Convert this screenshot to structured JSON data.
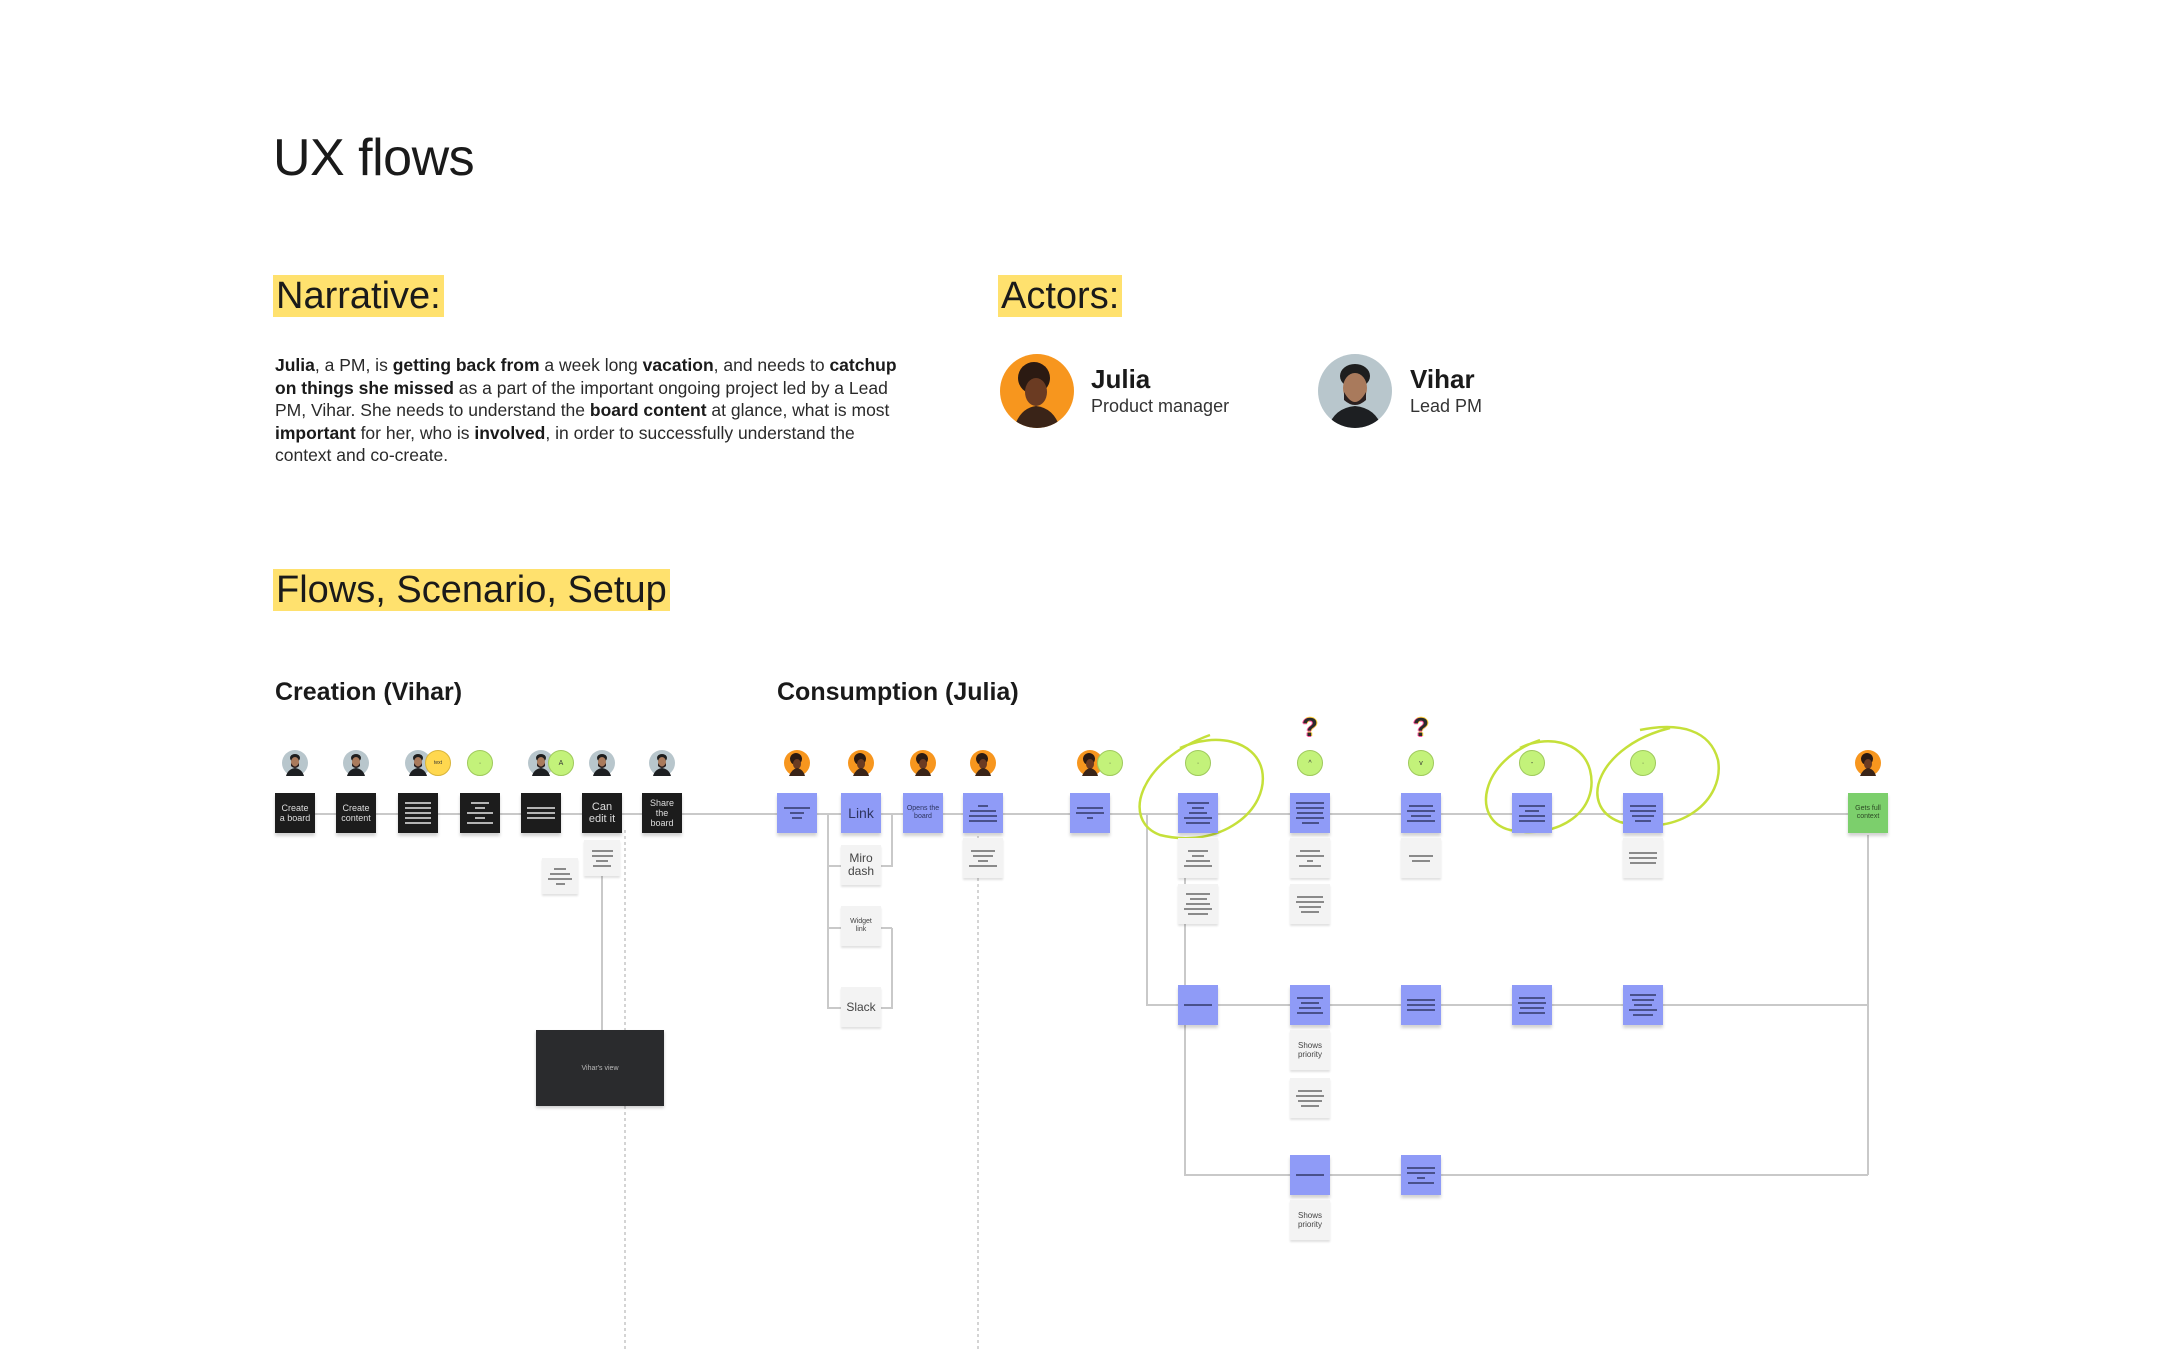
{
  "page": {
    "title": "UX flows"
  },
  "narrative": {
    "heading": "Narrative:",
    "segments": [
      {
        "text": "Julia",
        "bold": true
      },
      {
        "text": ", a PM, is ",
        "bold": false
      },
      {
        "text": "getting back from",
        "bold": true
      },
      {
        "text": " a week long ",
        "bold": false
      },
      {
        "text": "vacation",
        "bold": true
      },
      {
        "text": ", and needs to ",
        "bold": false
      },
      {
        "text": "catchup on things she missed",
        "bold": true
      },
      {
        "text": " as a part of the important ongoing project led by a Lead PM, Vihar. She needs to understand the ",
        "bold": false
      },
      {
        "text": "board content",
        "bold": true
      },
      {
        "text": " at glance, what is most ",
        "bold": false
      },
      {
        "text": "important",
        "bold": true
      },
      {
        "text": " for her, who is ",
        "bold": false
      },
      {
        "text": "involved",
        "bold": true
      },
      {
        "text": ", in order to successfully understand the context and co-create.",
        "bold": false
      }
    ]
  },
  "actors": {
    "heading": "Actors:",
    "list": [
      {
        "name": "Julia",
        "role": "Product manager",
        "avatar": "julia-avatar"
      },
      {
        "name": "Vihar",
        "role": "Lead PM",
        "avatar": "vihar-avatar"
      }
    ]
  },
  "flows": {
    "heading": "Flows, Scenario, Setup",
    "creation": {
      "heading": "Creation (Vihar)",
      "steps": [
        {
          "label": "Create a board",
          "actor": "vihar"
        },
        {
          "label": "Create content",
          "actor": "vihar"
        },
        {
          "label": "",
          "actor": "vihar",
          "badge": "yellow",
          "badge_text": "text"
        },
        {
          "label": "",
          "actor": "none",
          "badge": "green",
          "badge_text": "·"
        },
        {
          "label": "",
          "actor": "vihar",
          "badge": "green",
          "badge_text": "A"
        },
        {
          "label": "Can edit it",
          "actor": "vihar"
        },
        {
          "label": "Share the board",
          "actor": "vihar"
        }
      ],
      "result_box_label": "Vihar's view"
    },
    "consumption": {
      "heading": "Consumption (Julia)",
      "steps": [
        {
          "label": "",
          "actor": "julia"
        },
        {
          "label": "Link",
          "actor": "julia"
        },
        {
          "label": "Opens the board",
          "actor": "julia"
        },
        {
          "label": "",
          "actor": "julia"
        },
        {
          "label": "",
          "actor": "julia",
          "badge": "green",
          "badge_text": "·"
        },
        {
          "label": "",
          "actor": "none",
          "badge": "green",
          "badge_text": "·",
          "circled": true
        },
        {
          "label": "",
          "actor": "none",
          "badge": "green",
          "badge_text": "^",
          "question": true
        },
        {
          "label": "",
          "actor": "none",
          "badge": "green",
          "badge_text": "v",
          "question": true
        },
        {
          "label": "",
          "actor": "none",
          "badge": "green",
          "badge_text": "-",
          "circled": true
        },
        {
          "label": "",
          "actor": "none",
          "badge": "green",
          "badge_text": "·",
          "circled": true
        },
        {
          "label": "Gets full context",
          "actor": "julia",
          "final": true
        }
      ],
      "entry_channels": [
        "Miro dash",
        "Widget link",
        "Slack"
      ],
      "branch_notes": [
        "Shows priority",
        "Shows priority"
      ],
      "question_mark": "?"
    }
  },
  "colors": {
    "highlight": "#ffe16e",
    "sticky_blue": "#8f9bf7",
    "sticky_dark": "#1c1c1c",
    "sticky_green": "#7ccf6c",
    "badge_green": "#c3f27a",
    "badge_yellow": "#ffd84f",
    "annotation_lime": "#c5e03a"
  }
}
